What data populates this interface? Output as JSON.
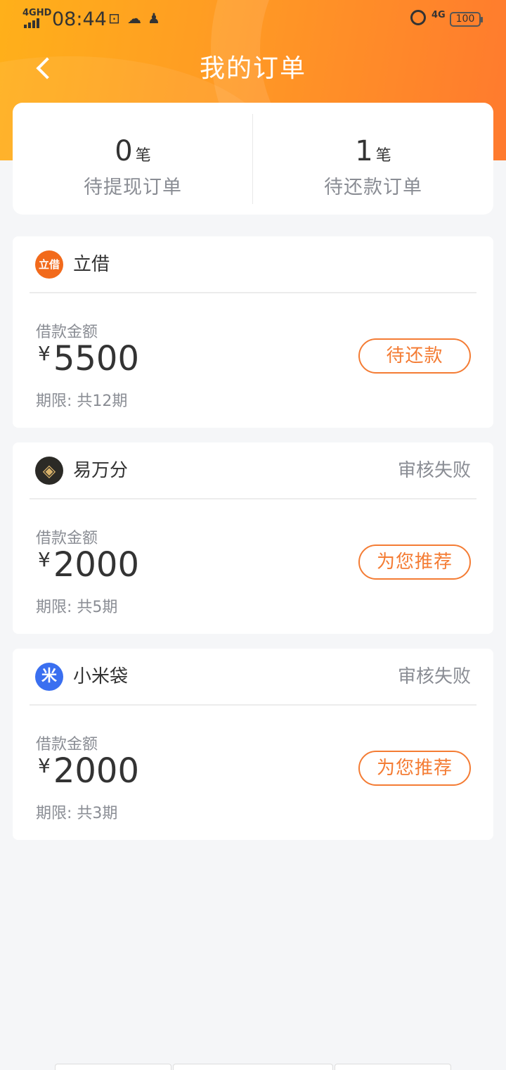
{
  "status_bar": {
    "network": "4GHD",
    "time": "08:44",
    "network_right": "4G",
    "battery": "100"
  },
  "header": {
    "title": "我的订单",
    "accent_color": "#ff9a24"
  },
  "summary": {
    "withdraw": {
      "count": "0",
      "unit": "笔",
      "label": "待提现订单"
    },
    "repay": {
      "count": "1",
      "unit": "笔",
      "label": "待还款订单"
    }
  },
  "orders": [
    {
      "name": "立借",
      "logo_text": "立借",
      "logo_color": "#f26a1b",
      "status": "",
      "amount_label": "借款金额",
      "currency": "¥",
      "amount": "5500",
      "term": "期限: 共12期",
      "action": "待还款"
    },
    {
      "name": "易万分",
      "logo_text": "◈",
      "logo_color": "#2b2a26",
      "status": "审核失败",
      "amount_label": "借款金额",
      "currency": "¥",
      "amount": "2000",
      "term": "期限: 共5期",
      "action": "为您推荐"
    },
    {
      "name": "小米袋",
      "logo_text": "米",
      "logo_color": "#3a6ff0",
      "status": "审核失败",
      "amount_label": "借款金额",
      "currency": "¥",
      "amount": "2000",
      "term": "期限: 共3期",
      "action": "为您推荐"
    }
  ]
}
